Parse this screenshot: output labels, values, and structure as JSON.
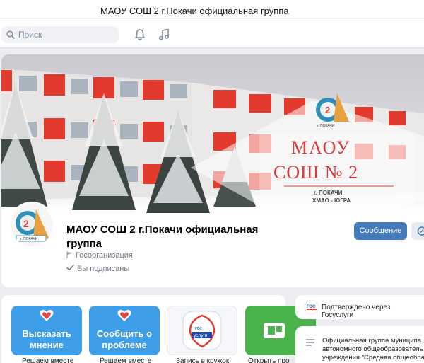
{
  "window": {
    "title": "МАОУ СОШ 2 г.Покачи официальная группа"
  },
  "header": {
    "search_placeholder": "Поиск",
    "icons": [
      "bell-icon",
      "music-icon"
    ]
  },
  "cover": {
    "sign_line1": "МАОУ",
    "sign_line2": "СОШ № 2",
    "sign_line3": "г. ПОКАЧИ,",
    "sign_line4": "ХМАО - ЮГРА",
    "emblem_text": "г. ПОКАЧИ"
  },
  "group": {
    "avatar_text": "г. ПОКАЧИ",
    "name": "МАОУ СОШ 2 г.Покачи официальная группа",
    "type": "Госорганизация",
    "subscribed": "Вы подписаны",
    "message_button": "Сообщение"
  },
  "apps": [
    {
      "text": "Высказать мнение",
      "caption": "Решаем вместе",
      "color": "#3e9ee8"
    },
    {
      "text": "Сообщить о проблеме",
      "caption": "Решаем вместе",
      "color": "#3e9ee8"
    },
    {
      "text": "",
      "caption": "Запись в кружок",
      "color": "#ffffff",
      "badge": "ГОС УСЛУГИ"
    },
    {
      "text": "",
      "caption": "Открыть про",
      "color": "#4bb34b"
    }
  ],
  "sidebar": {
    "gosuslugi": "Подтверждено через Госуслуги",
    "gos_badge": "ГОС",
    "description_lines": [
      "Официальная группа муниципа",
      "автономного общеобразователь",
      "учреждения \"Средняя общеобра"
    ]
  },
  "colors": {
    "accent": "#447bba",
    "tile_blue": "#3e9ee8",
    "tile_green": "#4bb34b",
    "building_red": "#e23b2e"
  }
}
